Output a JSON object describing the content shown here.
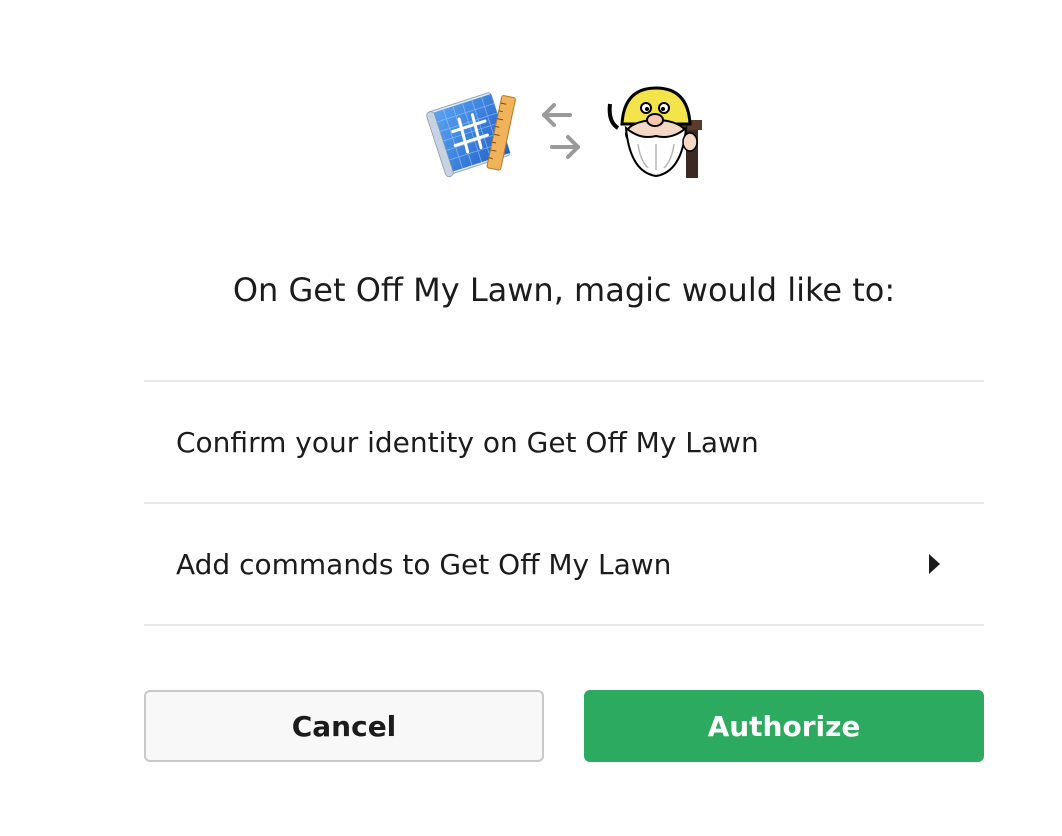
{
  "icons": {
    "app_icon": "blueprint-ruler-icon",
    "swap_icon": "swap-arrows-icon",
    "workspace_icon": "grumpy-wizard-workspace-icon"
  },
  "heading": "On Get Off My Lawn, magic would like to:",
  "permissions": [
    {
      "label": "Confirm your identity on Get Off My Lawn",
      "expandable": false
    },
    {
      "label": "Add commands to Get Off My Lawn",
      "expandable": true
    }
  ],
  "buttons": {
    "cancel_label": "Cancel",
    "authorize_label": "Authorize"
  },
  "colors": {
    "authorize_green": "#2baa60",
    "text": "#1d1c1d",
    "divider": "#e8e8e8"
  }
}
